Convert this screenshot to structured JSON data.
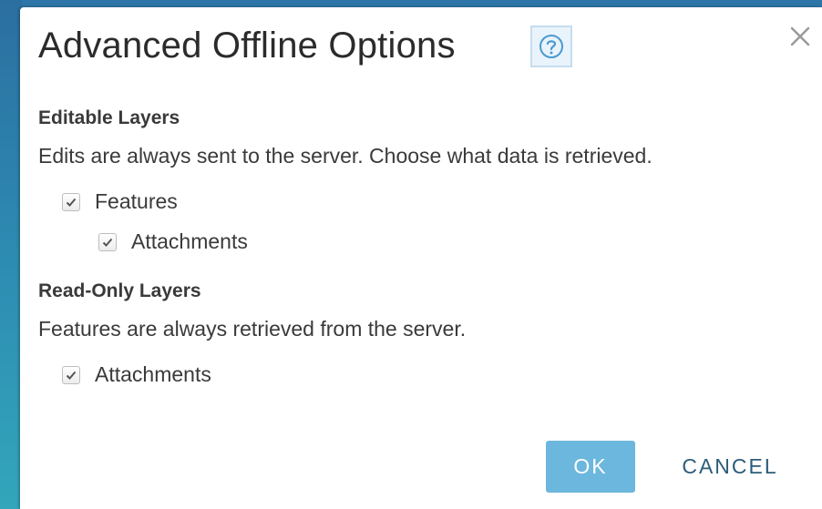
{
  "dialog": {
    "title": "Advanced Offline Options",
    "help_icon": "help-question-icon",
    "close_icon": "close-icon"
  },
  "editable_layers": {
    "heading": "Editable Layers",
    "description": "Edits are always sent to the server. Choose what data is retrieved.",
    "options": [
      {
        "label": "Features",
        "checked": true
      },
      {
        "label": "Attachments",
        "checked": true
      }
    ]
  },
  "readonly_layers": {
    "heading": "Read-Only Layers",
    "description": "Features are always retrieved from the server.",
    "options": [
      {
        "label": "Attachments",
        "checked": true
      }
    ]
  },
  "buttons": {
    "ok_label": "OK",
    "cancel_label": "CANCEL"
  },
  "colors": {
    "ok_button_bg": "#6cb7dd",
    "cancel_text": "#2b5d7a",
    "help_icon": "#4a9ad0",
    "backdrop": "#2f86b0"
  }
}
